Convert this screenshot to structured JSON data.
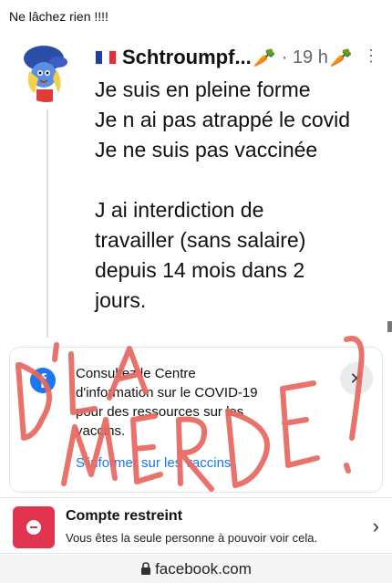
{
  "caption": "Ne lâchez rien !!!!",
  "tweet": {
    "author": "Schtroumpf...",
    "carrots": "🥕",
    "timestamp": "· 19 h",
    "more": "⋮",
    "lines": [
      "Je suis en pleine forme",
      "Je n ai pas atrappé le covid",
      "Je ne suis pas vaccinée",
      "",
      "J ai interdiction de",
      "travailler (sans salaire)",
      "depuis 14 mois dans 2",
      "jours."
    ]
  },
  "covid_info": {
    "text_lines": [
      "Consultez le Centre",
      "d'information sur le COVID-19",
      "pour des ressources sur les",
      "vaccins."
    ],
    "link": "S'informer sur les vaccins",
    "close": "✕"
  },
  "overlay": {
    "words": [
      "D'LA",
      "MERDE!"
    ],
    "color": "#e8675f"
  },
  "restricted": {
    "title": "Compte restreint",
    "subtitle": "Vous êtes la seule personne à pouvoir voir cela.",
    "chevron": "›"
  },
  "browser": {
    "url": "facebook.com"
  },
  "colors": {
    "facebook_blue": "#1877f2",
    "restricted_red": "#e1344f",
    "overlay_red": "#e8675f"
  }
}
